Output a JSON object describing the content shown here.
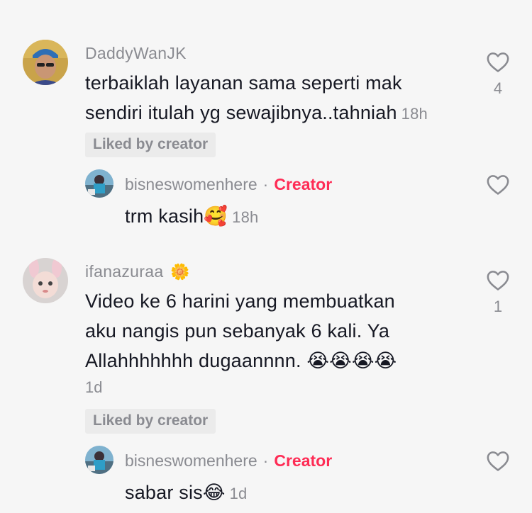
{
  "comments": [
    {
      "username": "DaddyWanJK",
      "text_line1": "terbaiklah layanan sama seperti mak",
      "text_line2": "sendiri itulah yg sewajibnya..tahniah",
      "time": "18h",
      "liked_label": "Liked by creator",
      "likes": "4",
      "reply": {
        "username": "bisneswomenhere",
        "separator": "·",
        "creator_label": "Creator",
        "text": "trm kasih",
        "emoji": "🥰",
        "time": "18h"
      }
    },
    {
      "username": "ifanazuraa",
      "username_emoji": "🌼",
      "text_line1": "Video ke 6 harini yang membuatkan",
      "text_line2": "aku nangis pun sebanyak 6 kali. Ya",
      "text_line3": "Allahhhhhhh dugaannnn.",
      "text_emojis": "😭😭😭😭",
      "time": "1d",
      "liked_label": "Liked by creator",
      "likes": "1",
      "reply": {
        "username": "bisneswomenhere",
        "separator": "·",
        "creator_label": "Creator",
        "text": "sabar sis",
        "emoji": "😂",
        "time": "1d"
      }
    }
  ]
}
